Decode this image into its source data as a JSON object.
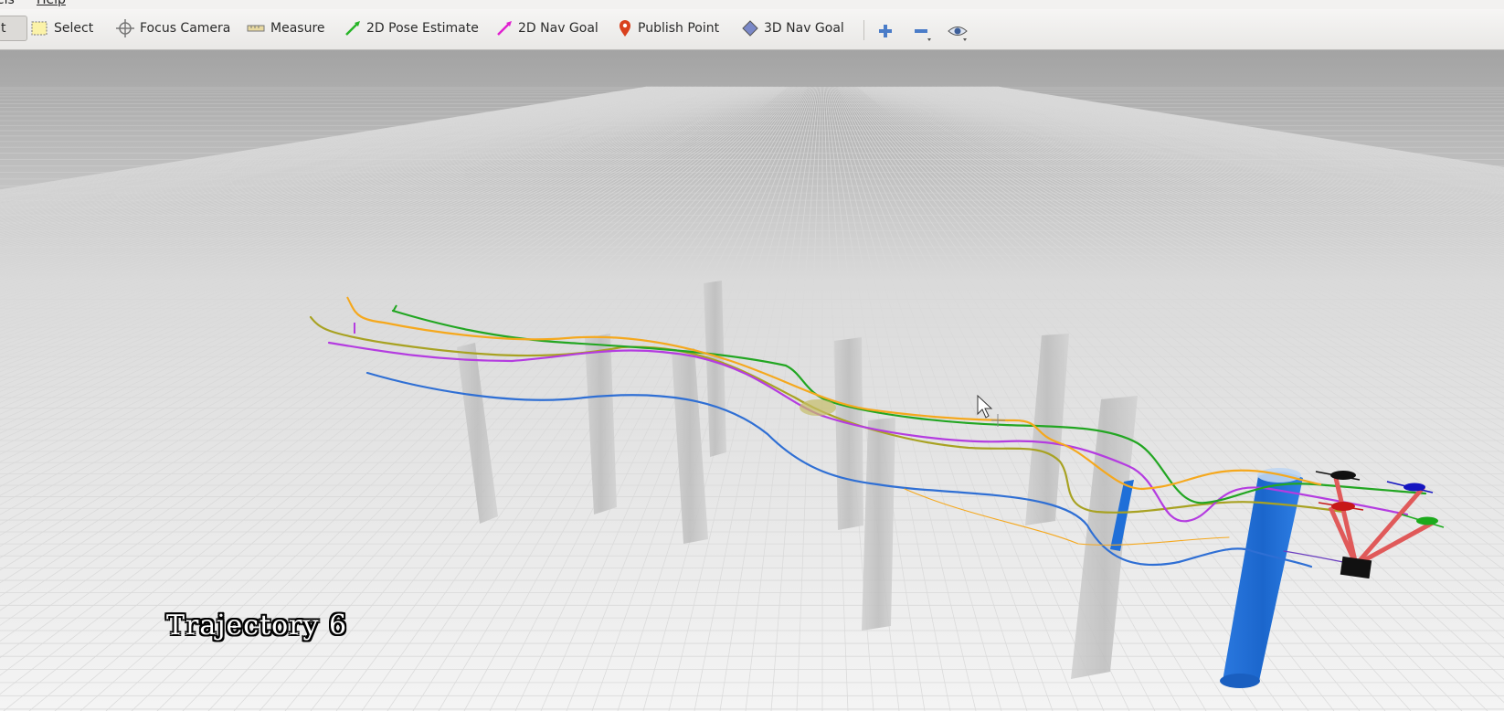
{
  "menubar": {
    "items": [
      "els",
      "Help"
    ]
  },
  "toolbar": {
    "tools": [
      {
        "id": "interact",
        "label": "t",
        "icon": "interact-icon",
        "active": true
      },
      {
        "id": "select",
        "label": "Select",
        "icon": "select-box-icon"
      },
      {
        "id": "focus-camera",
        "label": "Focus Camera",
        "icon": "crosshair-icon"
      },
      {
        "id": "measure",
        "label": "Measure",
        "icon": "ruler-icon"
      },
      {
        "id": "pose-estimate",
        "label": "2D Pose Estimate",
        "icon": "green-arrow-icon"
      },
      {
        "id": "nav-goal",
        "label": "2D Nav Goal",
        "icon": "magenta-arrow-icon"
      },
      {
        "id": "publish-point",
        "label": "Publish Point",
        "icon": "map-pin-icon"
      },
      {
        "id": "nav-goal-3d",
        "label": "3D Nav Goal",
        "icon": "diamond-icon"
      }
    ],
    "extra_icons": [
      "plus-icon",
      "minus-icon",
      "eye-icon"
    ]
  },
  "viewport": {
    "overlay_text": "Trajectory 6",
    "trajectory_colors": {
      "orange": "#f5a81d",
      "green": "#22a622",
      "purple": "#b43ce0",
      "olive": "#a8a222",
      "blue": "#2f6fd4"
    },
    "obstacle_color": "#1e6fd8",
    "grid_line_color": "#d9d9d9"
  }
}
